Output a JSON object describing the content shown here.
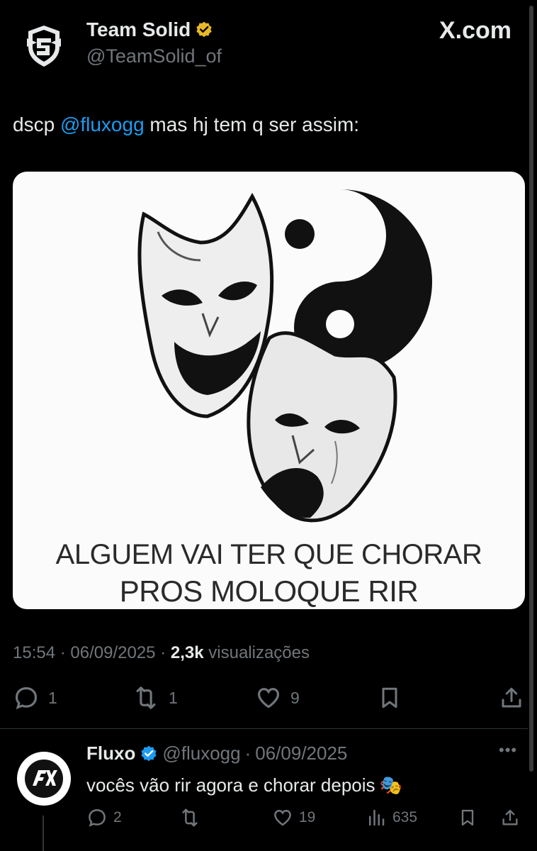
{
  "header": {
    "display_name": "Team Solid",
    "handle": "@TeamSolid_of",
    "site_badge": "X.com"
  },
  "tweet": {
    "text_prefix": "dscp ",
    "mention": "@fluxogg",
    "text_suffix": " mas hj tem q ser assim:",
    "image_caption_line1": "ALGUEM VAI TER QUE CHORAR",
    "image_caption_line2": "PROS MOLOQUE RIR",
    "time": "15:54",
    "date": "06/09/2025",
    "views_count": "2,3k",
    "views_label": "visualizações",
    "actions": {
      "replies": "1",
      "reposts": "1",
      "likes": "9"
    }
  },
  "reply": {
    "display_name": "Fluxo",
    "handle": "@fluxogg",
    "date": "06/09/2025",
    "text": "vocês vão rir agora e chorar depois",
    "emoji": "🎭",
    "actions": {
      "replies": "2",
      "reposts": "",
      "likes": "19",
      "views": "635"
    }
  },
  "colors": {
    "background": "#000000",
    "text_primary": "#e7e9ea",
    "text_secondary": "#71767b",
    "link": "#1d9bf0",
    "verified_gold": "#e8b829",
    "verified_blue": "#1d9bf0"
  },
  "icons": [
    "team-solid-logo-icon",
    "verified-gold-icon",
    "x-logo-icon",
    "reply-icon",
    "repost-icon",
    "like-icon",
    "bookmark-icon",
    "share-icon",
    "verified-blue-icon",
    "fluxo-logo-icon",
    "more-icon",
    "views-icon"
  ]
}
